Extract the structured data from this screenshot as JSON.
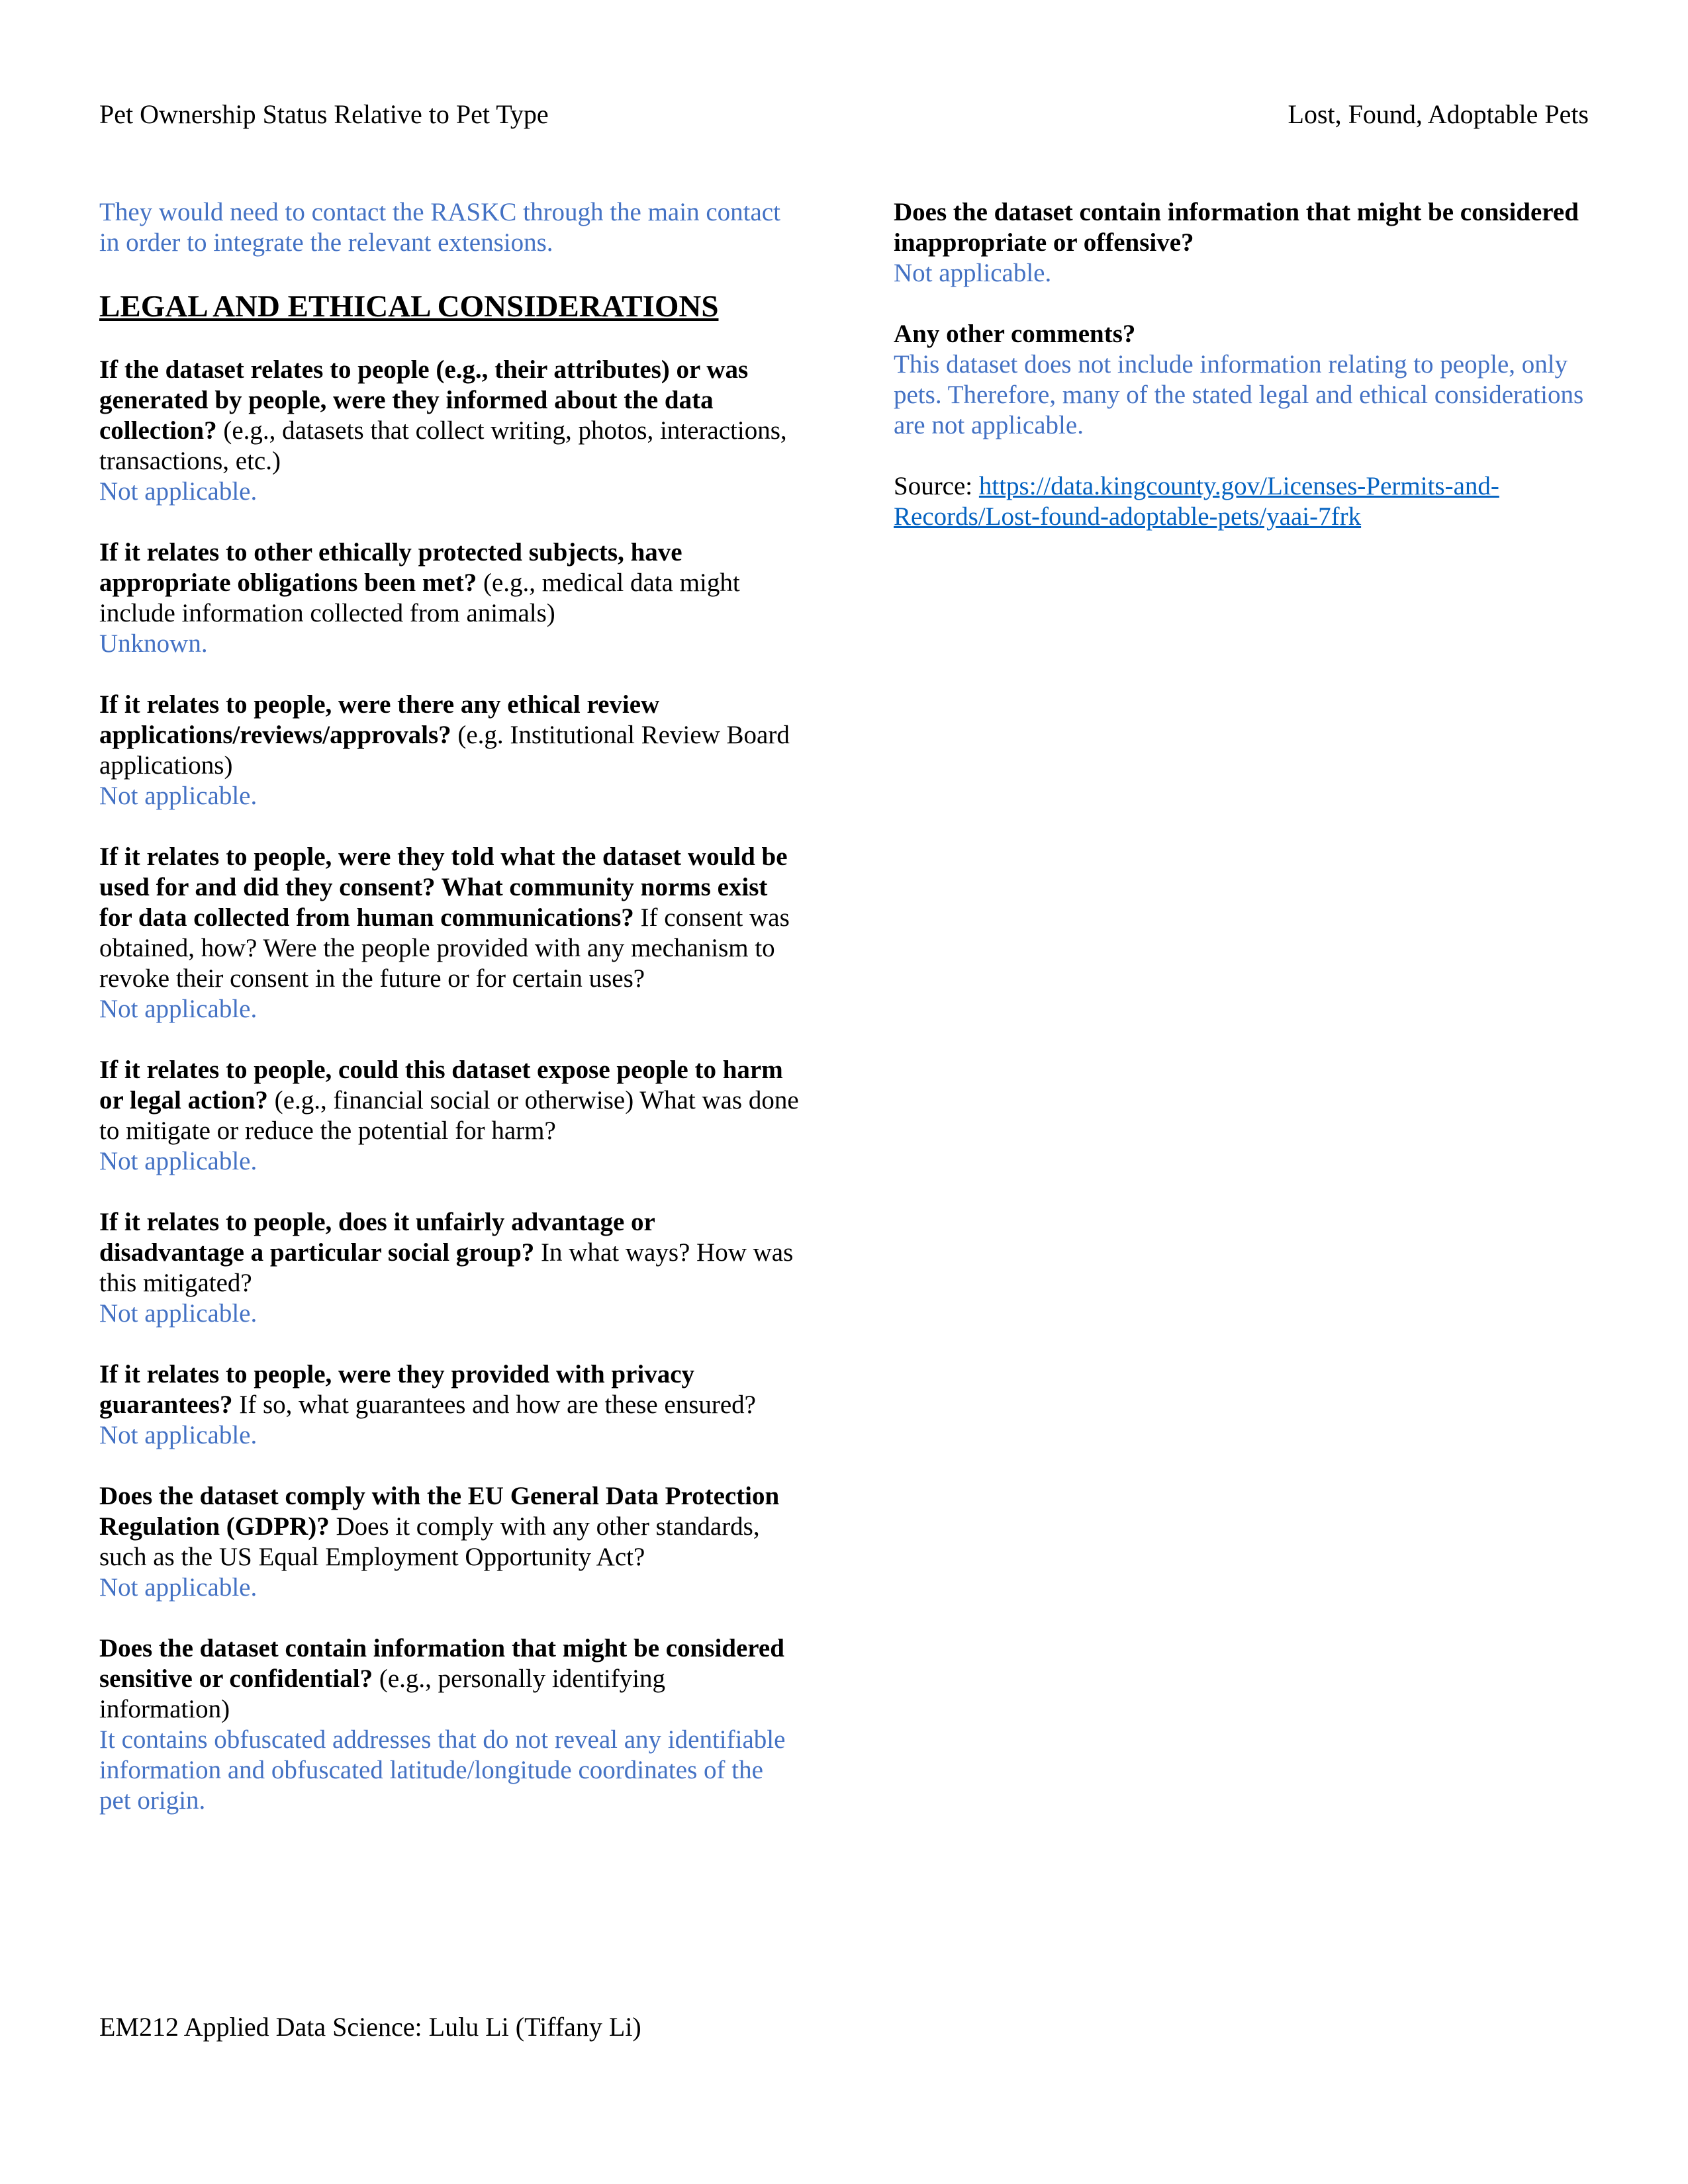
{
  "header": {
    "left": "Pet Ownership Status Relative to Pet Type",
    "right": "Lost, Found, Adoptable Pets"
  },
  "left_column": {
    "intro_answer": "They would need to contact the RASKC through the main contact in order to integrate the relevant extensions.",
    "section_heading": "LEGAL AND ETHICAL CONSIDERATIONS",
    "questions": [
      {
        "bold": "If the dataset relates to people (e.g., their attributes) or was generated by people, were they informed about the data collection?",
        "rest": " (e.g., datasets that collect writing, photos, interactions, transactions, etc.)",
        "answer": "Not applicable."
      },
      {
        "bold": "If it relates to other ethically protected subjects, have appropriate obligations been met?",
        "rest": " (e.g., medical data might include information collected from animals)",
        "answer": "Unknown."
      },
      {
        "bold": "If it relates to people, were there any ethical review applications/reviews/approvals?",
        "rest": " (e.g. Institutional Review Board applications)",
        "answer": "Not applicable."
      },
      {
        "bold": "If it relates to people, were they told what the dataset would be used for and did they consent? What community norms exist for data collected from human communications?",
        "rest": " If consent was obtained, how? Were the people provided with any mechanism to revoke their consent in the future or for certain uses?",
        "answer": "Not applicable."
      },
      {
        "bold": "If it relates to people, could this dataset expose people to harm or legal action?",
        "rest": " (e.g., financial social or otherwise) What was done to mitigate or reduce the potential for harm?",
        "answer": "Not applicable."
      },
      {
        "bold": "If it relates to people, does it unfairly advantage or disadvantage a particular social group?",
        "rest": " In what ways? How was this mitigated?",
        "answer": "Not applicable."
      },
      {
        "bold": "If it relates to people, were they provided with privacy guarantees?",
        "rest": " If so, what guarantees and how are these ensured?",
        "answer": "Not applicable."
      },
      {
        "bold": "Does the dataset comply with the EU General Data Protection Regulation (GDPR)?",
        "rest": " Does it comply with any other standards, such as the US Equal Employment Opportunity Act?",
        "answer": "Not applicable."
      },
      {
        "bold": "Does the dataset contain information that might be considered sensitive or confidential?",
        "rest": " (e.g., personally identifying information)",
        "answer": "It contains obfuscated addresses that do not reveal any identifiable information and obfuscated latitude/longitude coordinates of the pet origin."
      }
    ]
  },
  "right_column": {
    "questions": [
      {
        "bold": "Does the dataset contain information that might be considered inappropriate or offensive?",
        "answer": "Not applicable."
      },
      {
        "bold": "Any other comments?",
        "answer": "This dataset does not include information relating to people, only pets. Therefore, many of the stated legal and ethical considerations are not applicable."
      }
    ],
    "source_label": "Source: ",
    "source_link": "https://data.kingcounty.gov/Licenses-Permits-and-Records/Lost-found-adoptable-pets/yaai-7frk"
  },
  "footer": "EM212 Applied Data Science: Lulu Li (Tiffany Li)"
}
